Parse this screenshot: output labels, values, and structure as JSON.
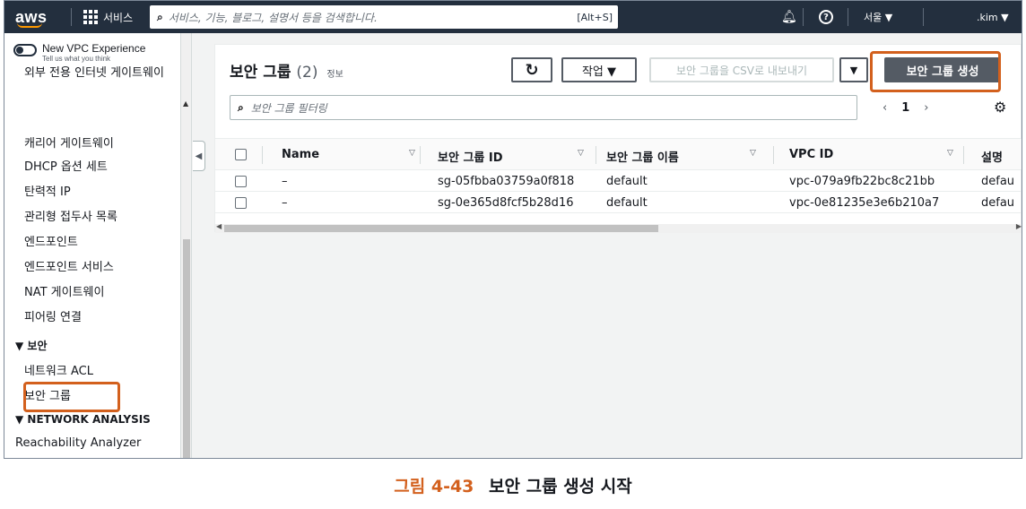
{
  "topnav": {
    "logo": "aws",
    "services": "서비스",
    "search_placeholder": "서비스, 기능, 블로그, 설명서 등을 검색합니다.",
    "search_shortcut": "[Alt+S]",
    "region": "서울 ▼",
    "user": ".kim ▼"
  },
  "sidebar": {
    "toggle_title": "New VPC Experience",
    "toggle_sub": "Tell us what you think",
    "items": [
      "외부 전용 인터넷 게이트웨이",
      "캐리어 게이트웨이",
      "DHCP 옵션 세트",
      "탄력적 IP",
      "관리형 접두사 목록",
      "엔드포인트",
      "엔드포인트 서비스",
      "NAT 게이트웨이",
      "피어링 연결"
    ],
    "security_head": "▼ 보안",
    "security_items": [
      "네트워크 ACL",
      "보안 그룹"
    ],
    "analysis_head": "▼ NETWORK ANALYSIS",
    "analysis_items": [
      "Reachability Analyzer"
    ]
  },
  "main": {
    "title": "보안 그룹",
    "count": "(2)",
    "info": "정보",
    "refresh_icon": "↻",
    "actions": "작업 ▼",
    "export": "보안 그룹을 CSV로 내보내기",
    "export_dropdown": "▼",
    "create": "보안 그룹 생성",
    "filter_placeholder": "보안 그룹 필터링",
    "page": "1",
    "columns": [
      "Name",
      "보안 그룹 ID",
      "보안 그룹 이름",
      "VPC ID",
      "설명"
    ],
    "rows": [
      {
        "name": "–",
        "id": "sg-05fbba03759a0f818",
        "group_name": "default",
        "vpc": "vpc-079a9fb22bc8c21bb",
        "desc": "defau"
      },
      {
        "name": "–",
        "id": "sg-0e365d8fcf5b28d16",
        "group_name": "default",
        "vpc": "vpc-0e81235e3e6b210a7",
        "desc": "defau"
      }
    ]
  },
  "caption": {
    "number": "그림 4-43",
    "text": "보안 그룹 생성 시작"
  },
  "colors": {
    "nav_bg": "#232f3e",
    "highlight": "#d3601d",
    "primary_btn": "#545b64"
  }
}
